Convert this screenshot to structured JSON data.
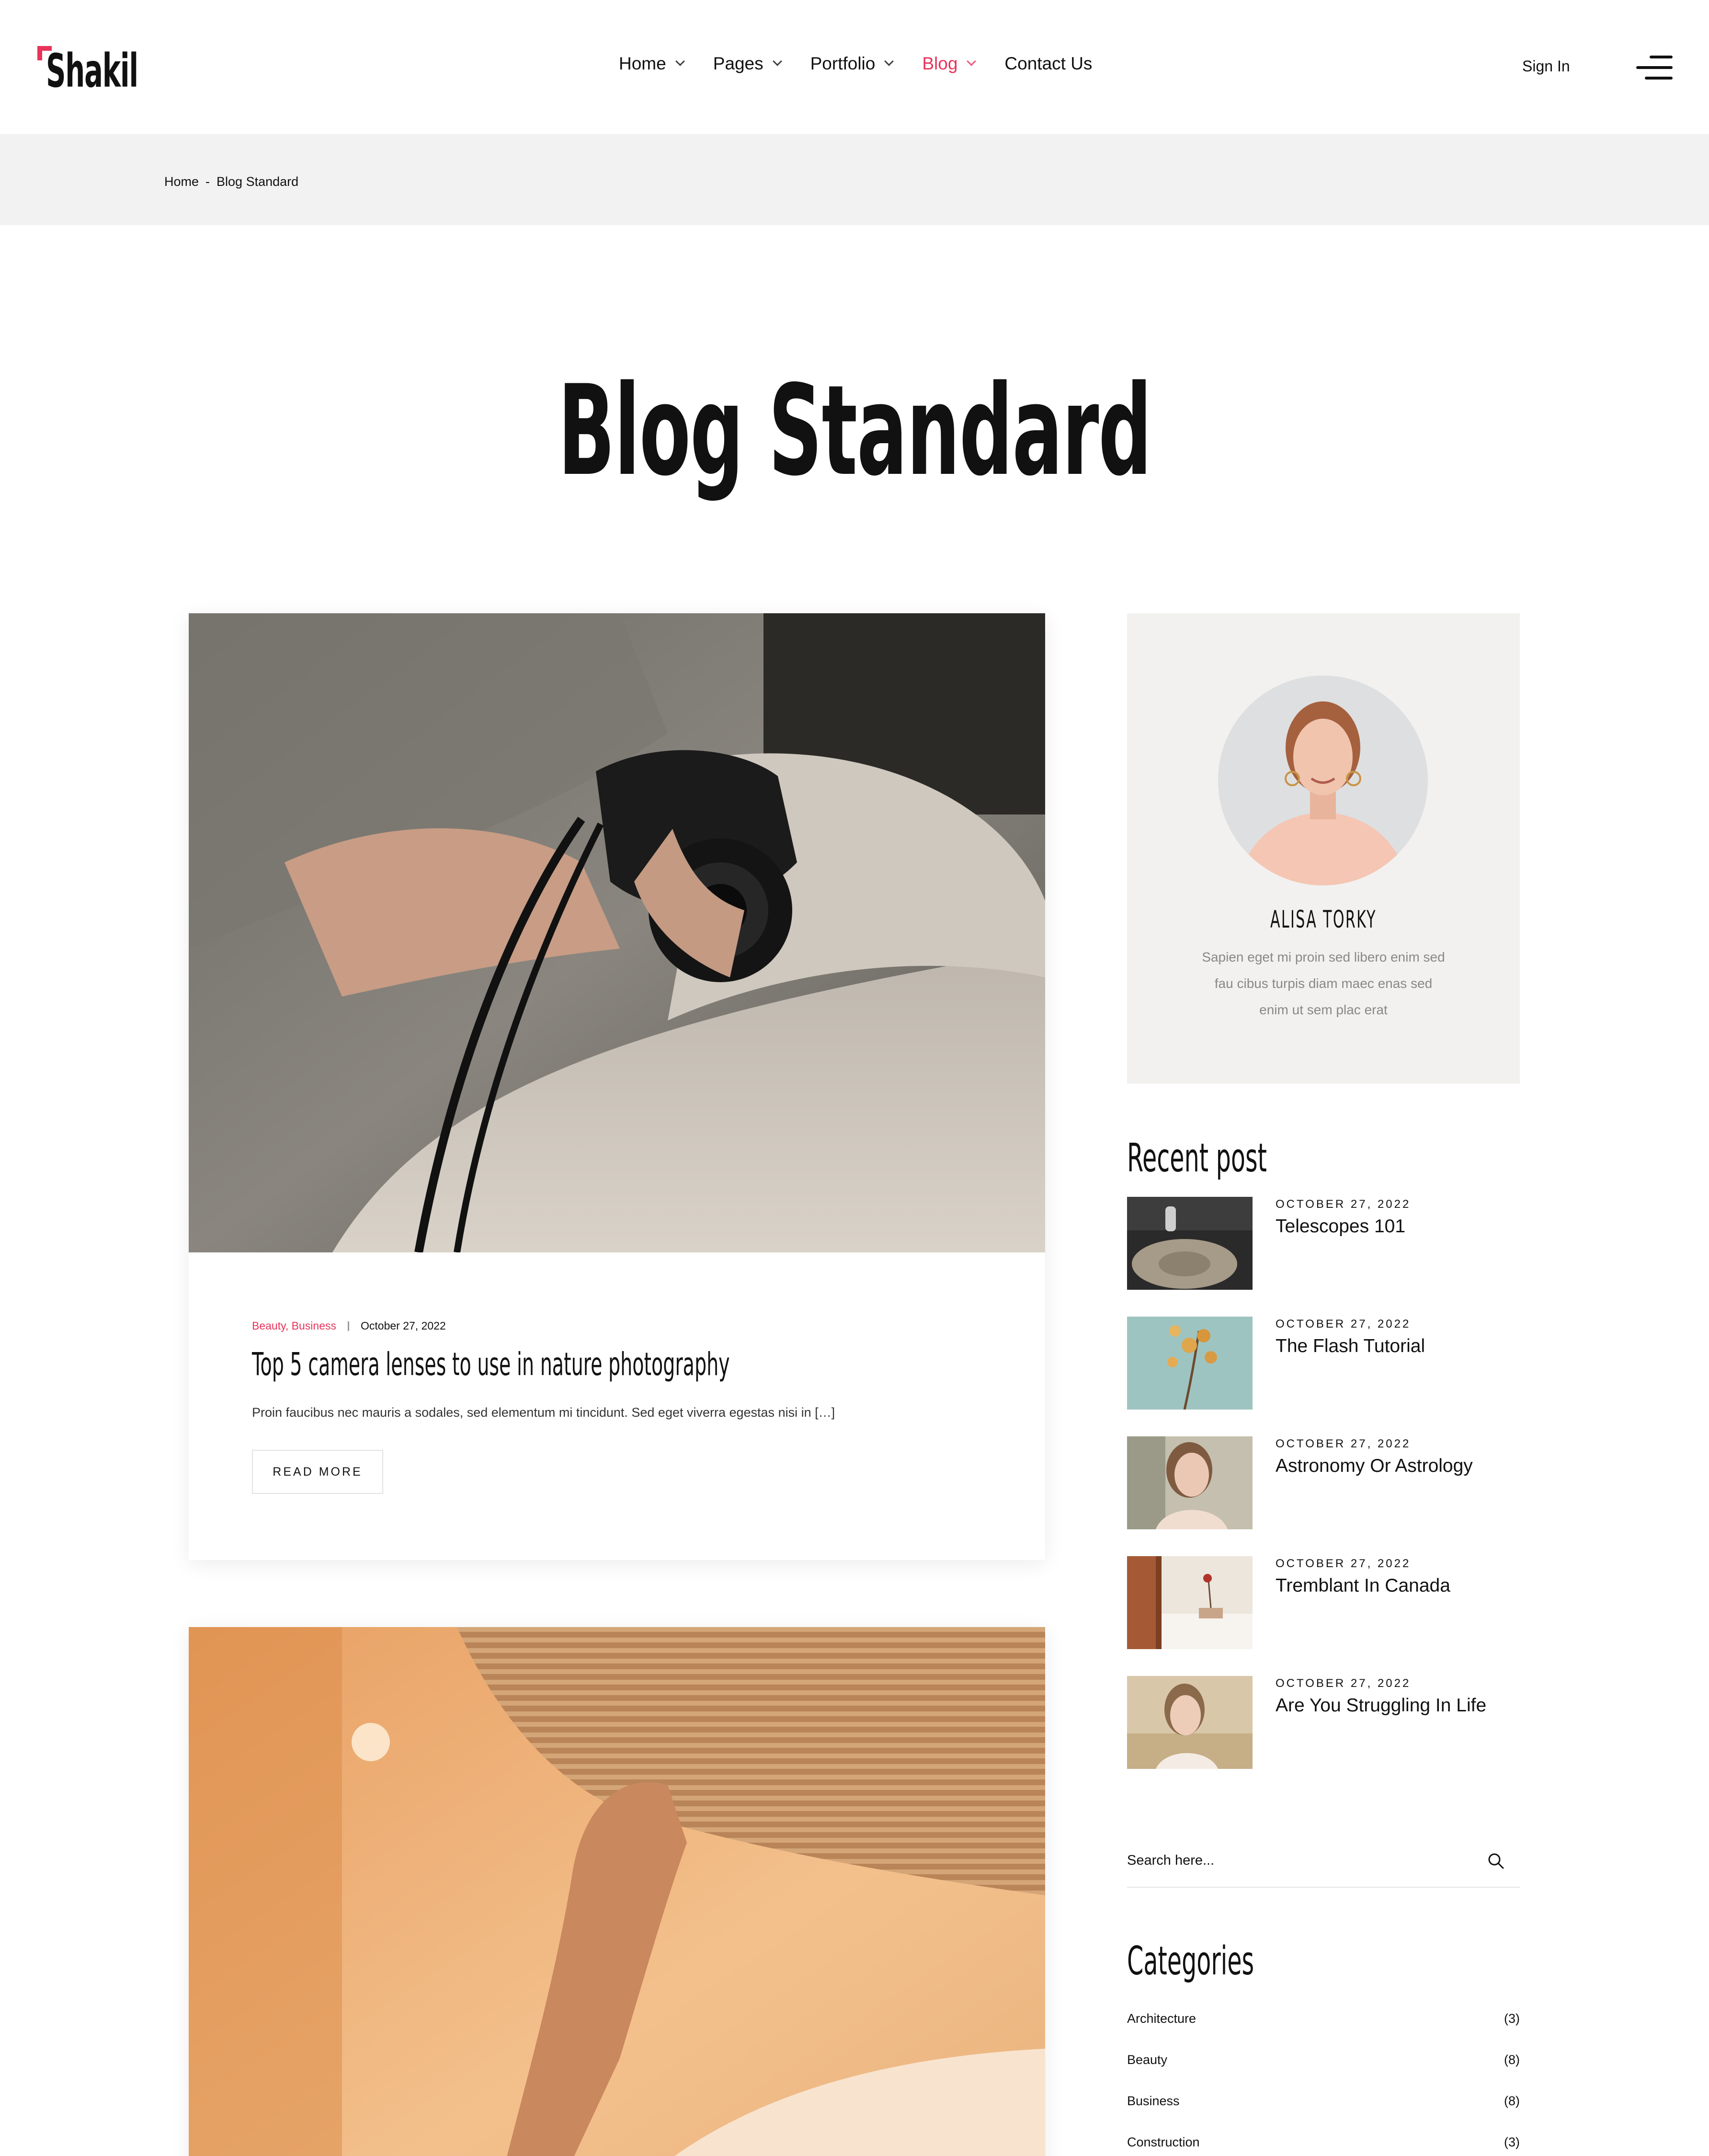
{
  "header": {
    "logo_text": "Shakil",
    "nav": [
      {
        "label": "Home",
        "has_dropdown": true,
        "active": false
      },
      {
        "label": "Pages",
        "has_dropdown": true,
        "active": false
      },
      {
        "label": "Portfolio",
        "has_dropdown": true,
        "active": false
      },
      {
        "label": "Blog",
        "has_dropdown": true,
        "active": true
      },
      {
        "label": "Contact Us",
        "has_dropdown": false,
        "active": false
      }
    ],
    "sign_in": "Sign In"
  },
  "breadcrumb": {
    "home": "Home",
    "separator": "-",
    "current": "Blog Standard"
  },
  "page_title": "Blog Standard",
  "posts": [
    {
      "categories": "Beauty, Business",
      "date": "October 27, 2022",
      "title": "Top 5 camera lenses to use in nature photography",
      "excerpt": "Proin faucibus nec mauris a sodales, sed elementum mi tincidunt. Sed eget viverra egestas nisi in […]",
      "read_more": "READ MORE"
    }
  ],
  "author": {
    "name": "ALISA TORKY",
    "bio_lines": [
      "Sapien eget mi proin sed libero enim sed",
      "fau cibus turpis diam maec enas sed",
      "enim ut sem plac erat"
    ]
  },
  "recent": {
    "heading": "Recent post",
    "items": [
      {
        "date": "OCTOBER 27, 2022",
        "title": "Telescopes 101"
      },
      {
        "date": "OCTOBER 27, 2022",
        "title": "The Flash Tutorial"
      },
      {
        "date": "OCTOBER 27, 2022",
        "title": "Astronomy Or Astrology"
      },
      {
        "date": "OCTOBER 27, 2022",
        "title": "Tremblant In Canada"
      },
      {
        "date": "OCTOBER 27, 2022",
        "title": "Are You Struggling In Life"
      }
    ]
  },
  "search": {
    "placeholder": "Search here..."
  },
  "categories": {
    "heading": "Categories",
    "items": [
      {
        "name": "Architecture",
        "count": "(3)"
      },
      {
        "name": "Beauty",
        "count": "(8)"
      },
      {
        "name": "Business",
        "count": "(8)"
      },
      {
        "name": "Construction",
        "count": "(3)"
      }
    ]
  },
  "colors": {
    "accent": "#e8335a",
    "breadcrumb_bg": "#f2f2f2",
    "author_card_bg": "#f2f1ef",
    "text": "#111111",
    "muted": "#888888"
  }
}
